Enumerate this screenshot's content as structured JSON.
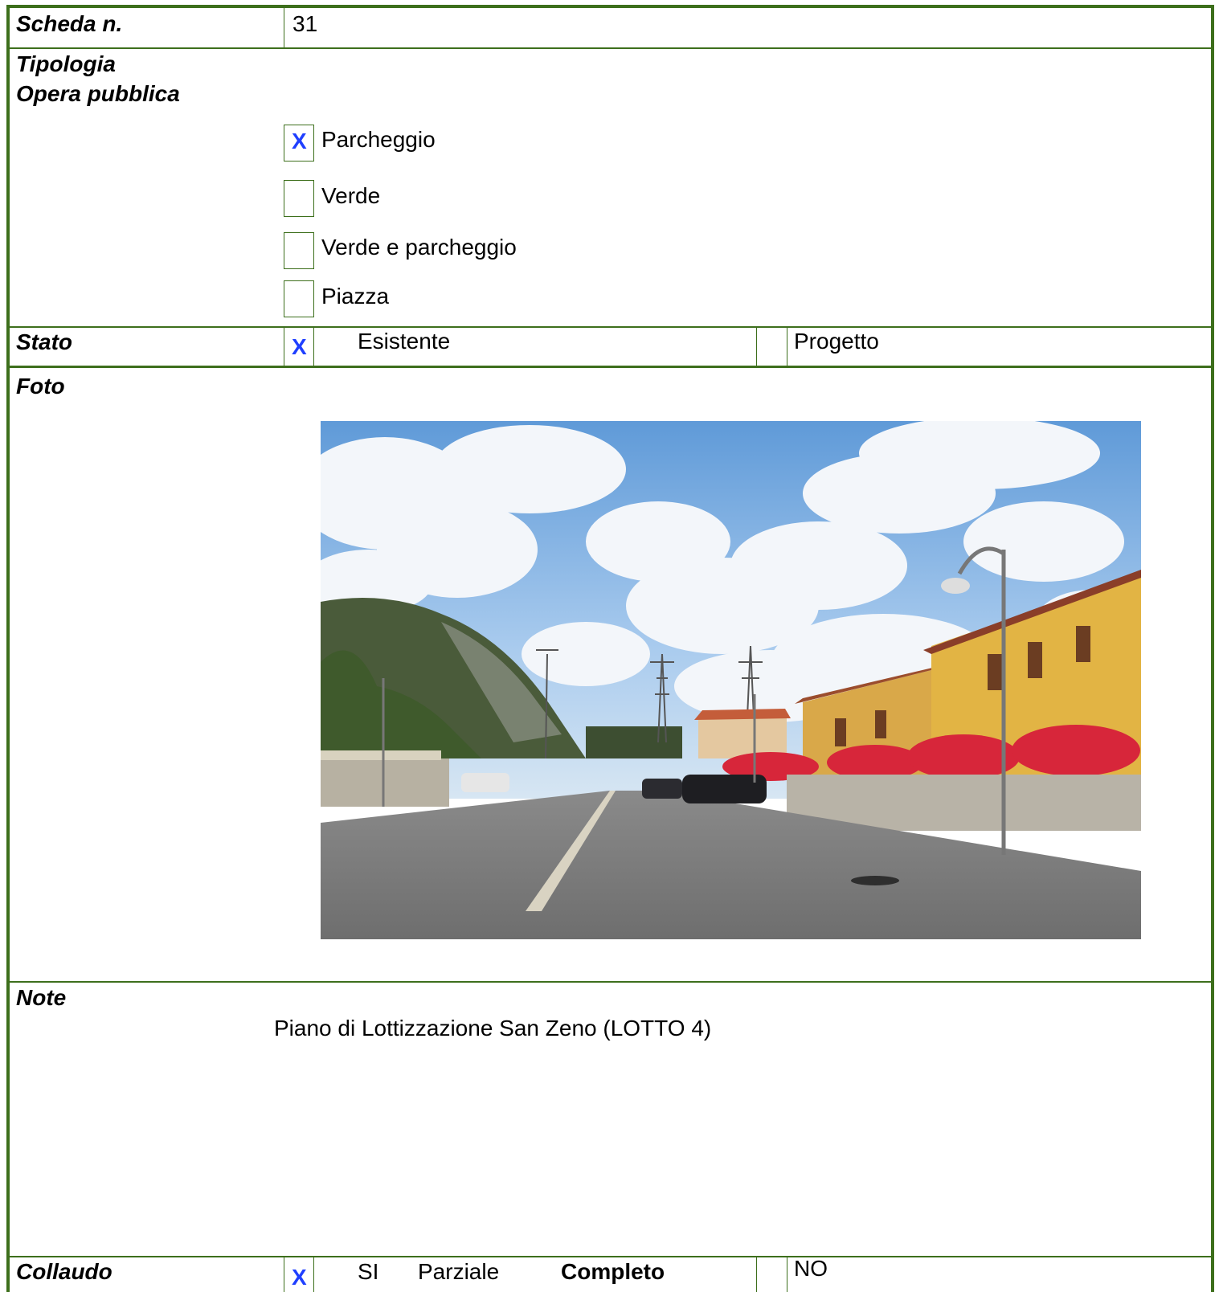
{
  "scheda": {
    "label": "Scheda n.",
    "value": "31"
  },
  "tipologia": {
    "label_line1": "Tipologia",
    "label_line2": "Opera pubblica",
    "options": [
      {
        "label": "Parcheggio",
        "checked": true,
        "mark": "X"
      },
      {
        "label": "Verde",
        "checked": false,
        "mark": ""
      },
      {
        "label": "Verde e parcheggio",
        "checked": false,
        "mark": ""
      },
      {
        "label": "Piazza",
        "checked": false,
        "mark": ""
      }
    ]
  },
  "stato": {
    "label": "Stato",
    "mark": "X",
    "esistente": "Esistente",
    "progetto": "Progetto"
  },
  "foto": {
    "label": "Foto"
  },
  "note": {
    "label": "Note",
    "text": "Piano di Lottizzazione San Zeno (LOTTO 4)"
  },
  "collaudo": {
    "label": "Collaudo",
    "mark": "X",
    "si": "SI",
    "parziale": "Parziale",
    "completo": "Completo",
    "no": "NO"
  },
  "colors": {
    "border": "#3d6f1c",
    "check_mark": "#1f3fff"
  }
}
